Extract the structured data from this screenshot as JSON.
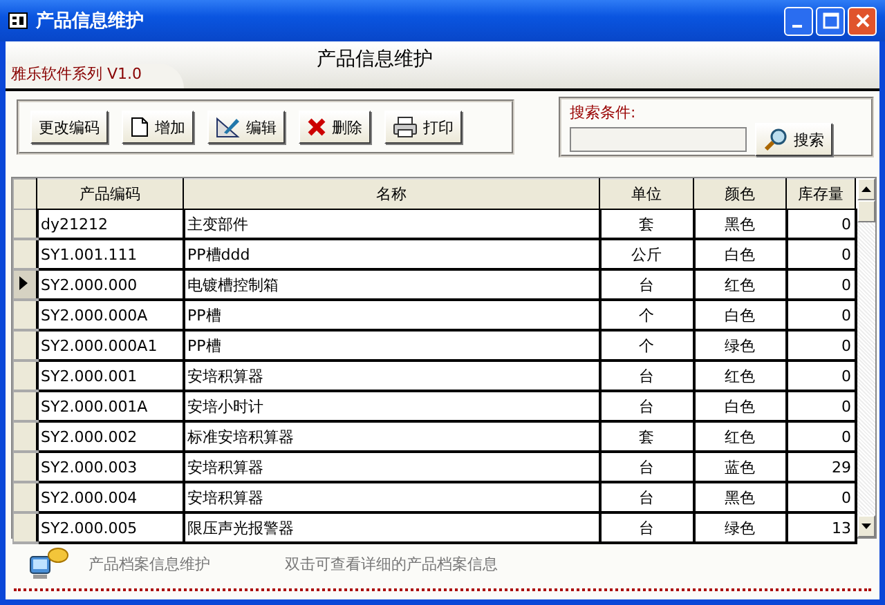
{
  "window": {
    "title": "产品信息维护"
  },
  "header": {
    "title": "产品信息维护",
    "brand": "雅乐软件系列 V1.0"
  },
  "toolbar": [
    {
      "kind": "plain",
      "label": "更改编码"
    },
    {
      "kind": "new",
      "label": "增加"
    },
    {
      "kind": "edit",
      "label": "编辑"
    },
    {
      "kind": "delete",
      "label": "删除"
    },
    {
      "kind": "print",
      "label": "打印"
    }
  ],
  "search": {
    "label": "搜索条件:",
    "button": "搜索"
  },
  "table": {
    "columns": [
      "产品编码",
      "名称",
      "单位",
      "颜色",
      "库存量"
    ],
    "rows": [
      {
        "selected": false,
        "cells": [
          "dy21212",
          "主变部件",
          "套",
          "黑色",
          "0"
        ]
      },
      {
        "selected": false,
        "cells": [
          "SY1.001.111",
          "PP槽ddd",
          "公斤",
          "白色",
          "0"
        ]
      },
      {
        "selected": true,
        "cells": [
          "SY2.000.000",
          "电镀槽控制箱",
          "台",
          "红色",
          "0"
        ]
      },
      {
        "selected": false,
        "cells": [
          "SY2.000.000A",
          "PP槽",
          "个",
          "白色",
          "0"
        ]
      },
      {
        "selected": false,
        "cells": [
          "SY2.000.000A1",
          "PP槽",
          "个",
          "绿色",
          "0"
        ]
      },
      {
        "selected": false,
        "cells": [
          "SY2.000.001",
          "安培积算器",
          "台",
          "红色",
          "0"
        ]
      },
      {
        "selected": false,
        "cells": [
          "SY2.000.001A",
          "安培小时计",
          "台",
          "白色",
          "0"
        ]
      },
      {
        "selected": false,
        "cells": [
          "SY2.000.002",
          "标准安培积算器",
          "套",
          "红色",
          "0"
        ]
      },
      {
        "selected": false,
        "cells": [
          "SY2.000.003",
          "安培积算器",
          "台",
          "蓝色",
          "29"
        ]
      },
      {
        "selected": false,
        "cells": [
          "SY2.000.004",
          "安培积算器",
          "台",
          "黑色",
          "0"
        ]
      },
      {
        "selected": false,
        "cells": [
          "SY2.000.005",
          "限压声光报警器",
          "台",
          "绿色",
          "13"
        ]
      }
    ]
  },
  "footer": {
    "title": "产品档案信息维护",
    "hint": "双击可查看详细的产品档案信息"
  }
}
